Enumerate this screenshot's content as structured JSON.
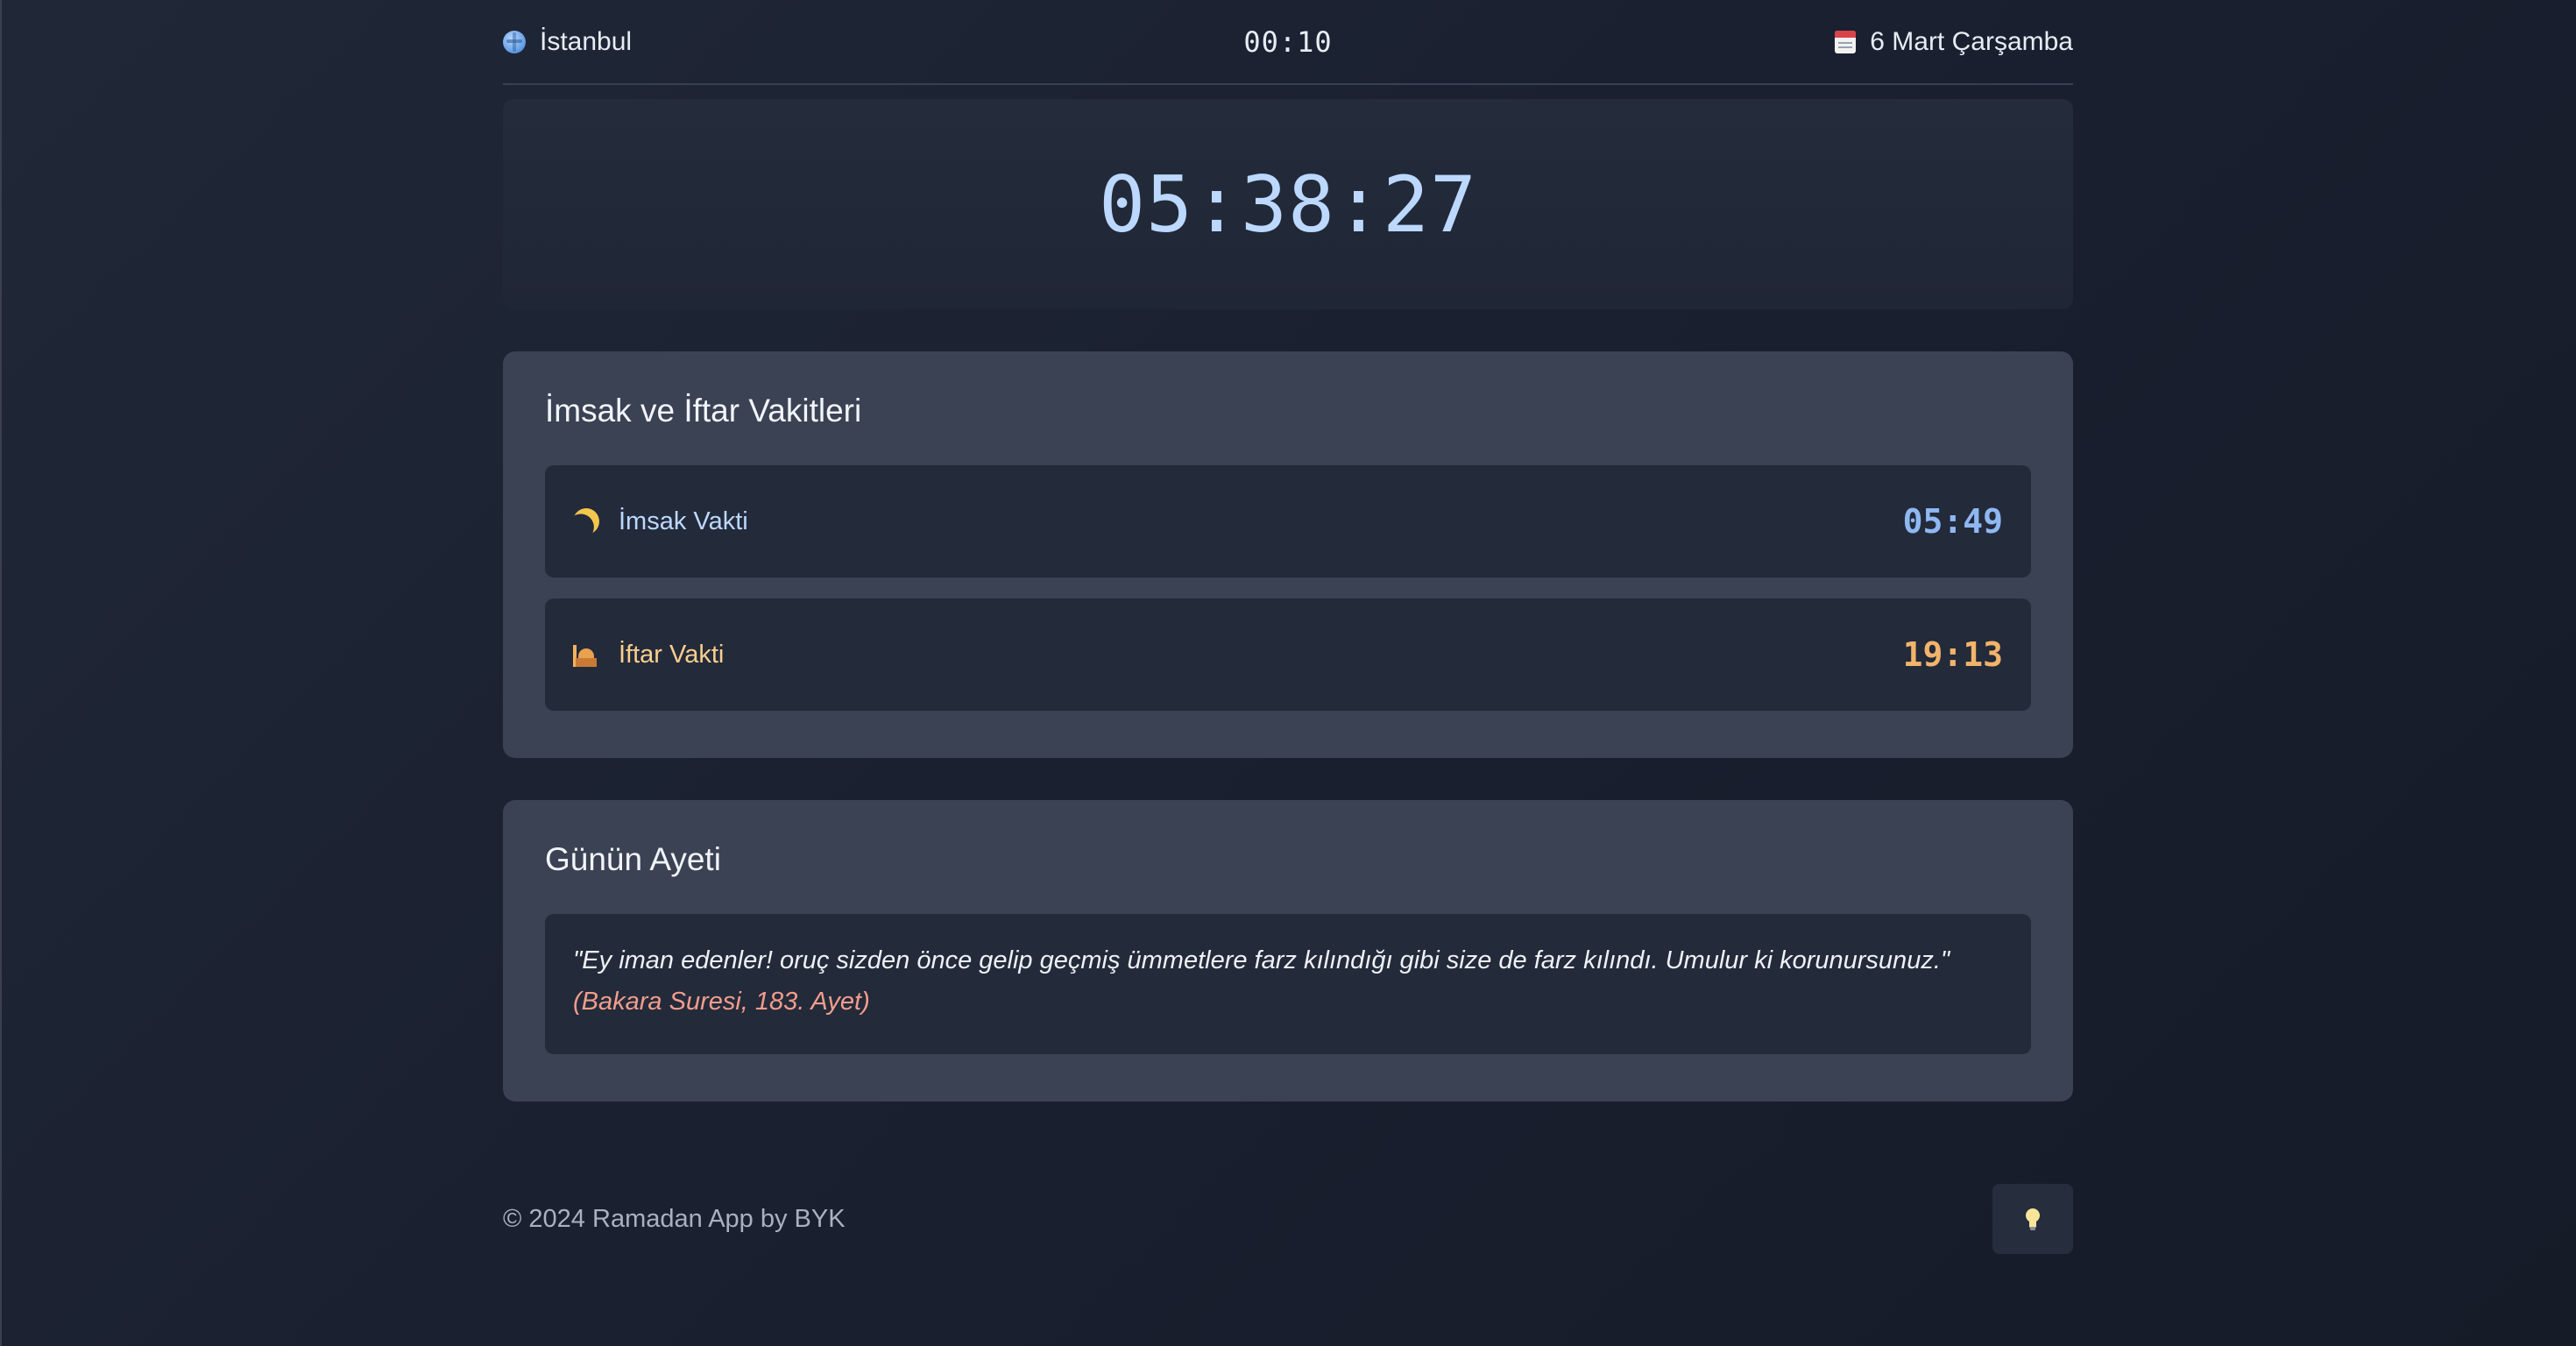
{
  "header": {
    "city": "İstanbul",
    "current_time": "00:10",
    "date": "6 Mart Çarşamba",
    "city_icon": "globe-icon",
    "date_icon": "calendar-icon"
  },
  "countdown": {
    "value": "05:38:27"
  },
  "times_panel": {
    "title": "İmsak ve İftar Vakitleri",
    "rows": [
      {
        "icon": "crescent-moon-icon",
        "label": "İmsak Vakti",
        "time": "05:49"
      },
      {
        "icon": "mosque-icon",
        "label": "İftar Vakti",
        "time": "19:13"
      }
    ]
  },
  "ayet_panel": {
    "title": "Günün Ayeti",
    "text": "\"Ey iman edenler! oruç sizden önce gelip geçmiş ümmetlere farz kılındığı gibi size de farz kılındı. Umulur ki korunursunuz.\"",
    "reference": "(Bakara Suresi, 183. Ayet)"
  },
  "footer": {
    "copyright": "© 2024 Ramadan App by BYK",
    "theme_icon": "light-bulb-icon"
  },
  "colors": {
    "countdown": "#bcd8ff",
    "imsak_time": "#8fb8f2",
    "iftar_time": "#f2b46a",
    "reference": "#f29d8c",
    "panel_bg": "#3b4253",
    "row_bg": "#232a3a"
  }
}
